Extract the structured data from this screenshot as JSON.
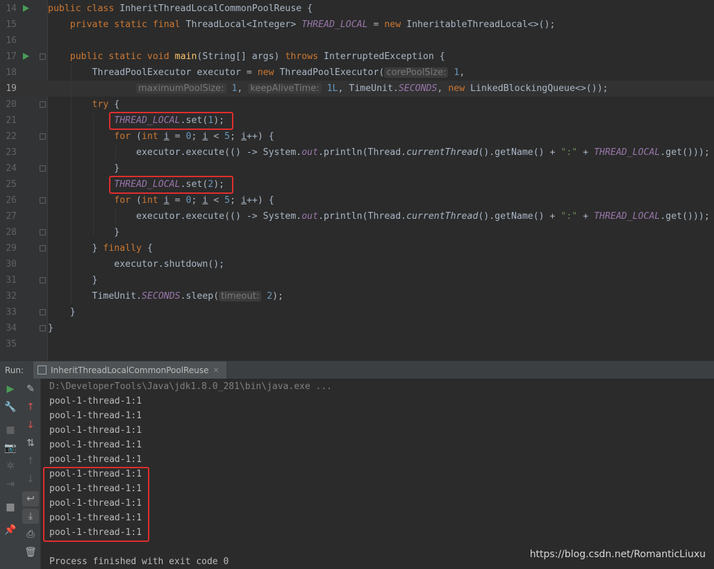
{
  "editor": {
    "line_numbers": [
      "14",
      "15",
      "16",
      "17",
      "18",
      "19",
      "20",
      "21",
      "22",
      "23",
      "24",
      "25",
      "26",
      "27",
      "28",
      "29",
      "30",
      "31",
      "32",
      "33",
      "34",
      "35"
    ],
    "code": {
      "class_name": "InheritThreadLocalCommonPoolReuse",
      "field_type": "ThreadLocal<Integer>",
      "field_name": "THREAD_LOCAL",
      "field_init": "InheritableThreadLocal<>();",
      "main_params": "(String[] args)",
      "main_exception": "InterruptedException {",
      "executor_decl": "ThreadPoolExecutor executor = ",
      "executor_ctor": "ThreadPoolExecutor(",
      "hint_core": "corePoolSize:",
      "hint_max": "maximumPoolSize:",
      "hint_keepalive": "keepAliveTime:",
      "hint_timeout": "timeout:",
      "core_value": "1",
      "max_value": "1",
      "keepalive_value": "1L",
      "time_unit": "TimeUnit.",
      "seconds": "SECONDS",
      "queue": "LinkedBlockingQueue<>());",
      "set_call": ".set(",
      "first_value": "1",
      "second_value": "2",
      "loop_limit": "5",
      "exec_call": "executor.execute(() -> System.",
      "out": "out",
      "println": ".println(Thread.",
      "current_thread": "currentThread",
      "get_name": "().getName() + ",
      "colon_string": "\":\"",
      "get_call": ".get()));",
      "shutdown": "executor.shutdown();",
      "sleep": ".sleep(",
      "sleep_value": "2"
    }
  },
  "run_panel": {
    "label": "Run:",
    "tab_label": "InheritThreadLocalCommonPoolReuse",
    "tab_close": "×",
    "toolbar_left": [
      {
        "name": "rerun-icon",
        "glyph": "▶"
      },
      {
        "name": "wrench-icon",
        "glyph": "🔧"
      },
      {
        "name": "stop-icon",
        "glyph": "■"
      },
      {
        "name": "camera-icon",
        "glyph": "📷"
      },
      {
        "name": "debug-icon",
        "glyph": "✲"
      },
      {
        "name": "exit-icon",
        "glyph": "⇥"
      },
      {
        "name": "layout-icon",
        "glyph": "▦"
      },
      {
        "name": "pin-icon",
        "glyph": "📌"
      }
    ],
    "toolbar_right": [
      {
        "name": "edit-icon",
        "glyph": "✎"
      },
      {
        "name": "arrow-up-icon",
        "glyph": "↑"
      },
      {
        "name": "arrow-down-icon",
        "glyph": "↓"
      },
      {
        "name": "sort-icon",
        "glyph": "⇅"
      },
      {
        "name": "up-icon",
        "glyph": "↑"
      },
      {
        "name": "down-icon",
        "glyph": "↓"
      },
      {
        "name": "soft-wrap-icon",
        "glyph": "↩"
      },
      {
        "name": "scroll-to-end-icon",
        "glyph": "⤓"
      },
      {
        "name": "print-icon",
        "glyph": "⎙"
      },
      {
        "name": "trash-icon",
        "glyph": "🗑"
      }
    ]
  },
  "console": {
    "command": "D:\\DeveloperTools\\Java\\jdk1.8.0_281\\bin\\java.exe ...",
    "output_lines": [
      "pool-1-thread-1:1",
      "pool-1-thread-1:1",
      "pool-1-thread-1:1",
      "pool-1-thread-1:1",
      "pool-1-thread-1:1",
      "pool-1-thread-1:1",
      "pool-1-thread-1:1",
      "pool-1-thread-1:1",
      "pool-1-thread-1:1",
      "pool-1-thread-1:1"
    ],
    "exit_message": "Process finished with exit code 0"
  },
  "watermark": "https://blog.csdn.net/RomanticLiuxu",
  "colors": {
    "accent_run": "#499c54",
    "highlight_box": "#e12d2d",
    "keyword": "#cc7832",
    "constant": "#9876aa"
  }
}
